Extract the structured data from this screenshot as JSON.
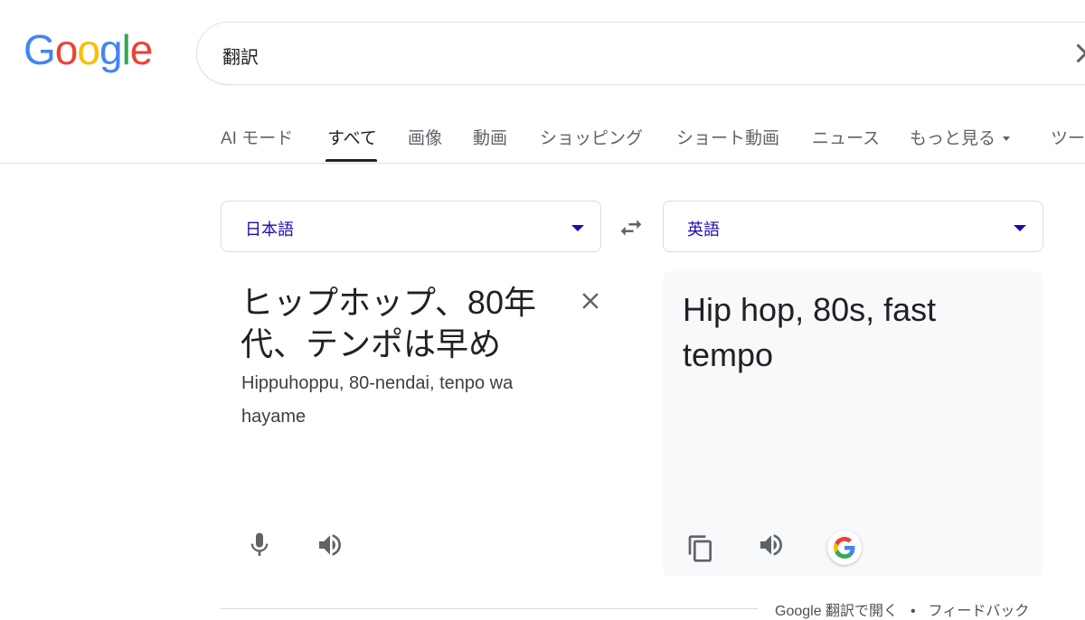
{
  "logo": {
    "letters": [
      "G",
      "o",
      "o",
      "g",
      "l",
      "e"
    ],
    "colors": [
      "#4285F4",
      "#EA4335",
      "#FBBC05",
      "#4285F4",
      "#34A853",
      "#EA4335"
    ]
  },
  "search": {
    "query": "翻訳"
  },
  "tabs": [
    {
      "label": "AI モード"
    },
    {
      "label": "すべて",
      "active": true
    },
    {
      "label": "画像"
    },
    {
      "label": "動画"
    },
    {
      "label": "ショッピング"
    },
    {
      "label": "ショート動画"
    },
    {
      "label": "ニュース"
    },
    {
      "label": "もっと見る"
    },
    {
      "label": "ツー"
    }
  ],
  "translator": {
    "source_lang": "日本語",
    "target_lang": "英語",
    "source_text": "ヒップホップ、80年代、テンポは早め",
    "romanization": "Hippuhoppu, 80-nendai, tenpo wa hayame",
    "target_text": "Hip hop, 80s, fast tempo",
    "accent_color": "#1a0dab"
  },
  "footer": {
    "open_link": "Google 翻訳で開く",
    "separator": "•",
    "feedback": "フィードバック"
  }
}
